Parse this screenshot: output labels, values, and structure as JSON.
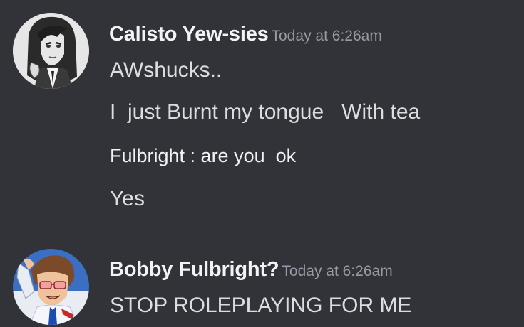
{
  "messages": [
    {
      "author": "Calisto Yew-sies",
      "timestamp": "Today at 6:26am",
      "avatar_icon": "grayscale-character-avatar",
      "lines": [
        "AWshucks..",
        "I  just Burnt my tongue   With tea",
        "Fulbright : are you  ok",
        "Yes"
      ]
    },
    {
      "author": "Bobby Fulbright?",
      "timestamp": "Today at 6:26am",
      "avatar_icon": "saluting-character-avatar",
      "lines": [
        "STOP ROLEPLAYING FOR ME"
      ]
    }
  ],
  "colors": {
    "background": "#313338",
    "username": "#f2f3f5",
    "timestamp": "#949ba4",
    "message_text": "#dbdee1"
  }
}
